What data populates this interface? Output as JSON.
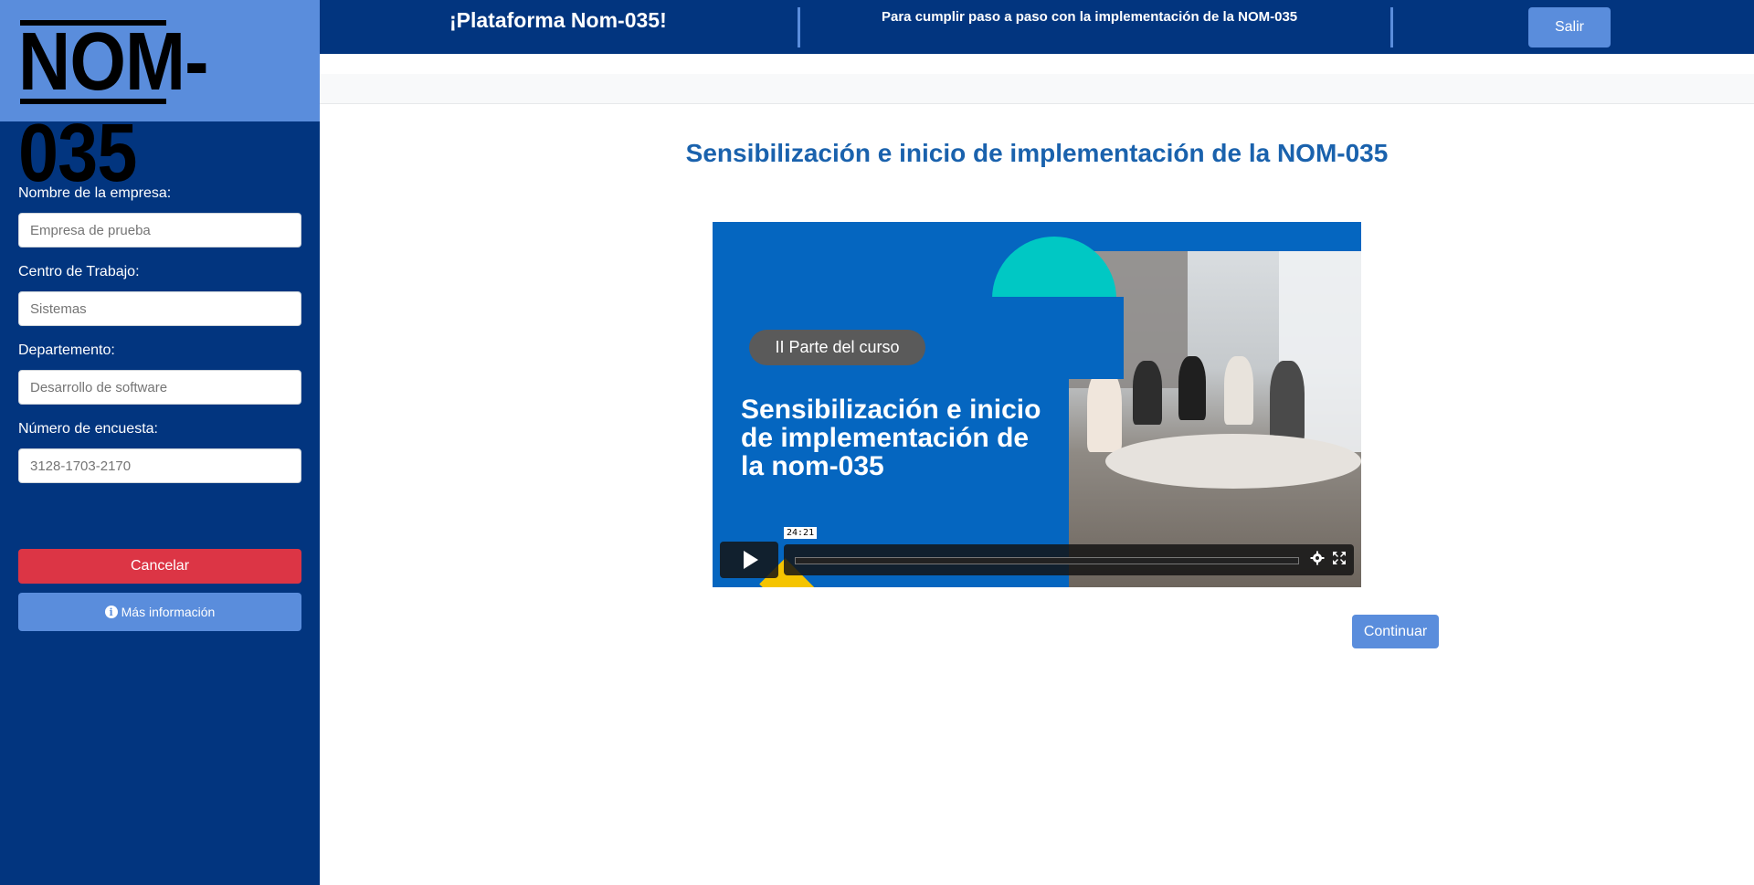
{
  "logo": {
    "text": "NOM-035"
  },
  "sidebar": {
    "fields": [
      {
        "label": "Nombre de la empresa:",
        "placeholder": "Empresa de prueba"
      },
      {
        "label": "Centro de Trabajo:",
        "placeholder": "Sistemas"
      },
      {
        "label": "Departemento:",
        "placeholder": "Desarrollo de software"
      },
      {
        "label": "Número de encuesta:",
        "placeholder": "3128-1703-2170"
      }
    ],
    "cancel_label": "Cancelar",
    "info_label": "Más información"
  },
  "header": {
    "title": "¡Plataforma Nom-035!",
    "subtitle": "Para cumplir paso a paso con la implementación de la NOM-035",
    "exit_label": "Salir"
  },
  "main": {
    "title": "Sensibilización e inicio de implementación de la NOM-035",
    "continue_label": "Continuar"
  },
  "video": {
    "pill": "II Parte del curso",
    "heading": "Sensibilización e inicio de implementación de la nom-035",
    "duration": "24:21",
    "icons": [
      "play-icon",
      "gear-icon",
      "fullscreen-icon"
    ]
  },
  "colors": {
    "navy": "#02357f",
    "accent": "#5a8ddc",
    "danger": "#dc3545",
    "title_blue": "#1a62ad",
    "video_blue": "#0566c0",
    "teal": "#00c8c4"
  }
}
